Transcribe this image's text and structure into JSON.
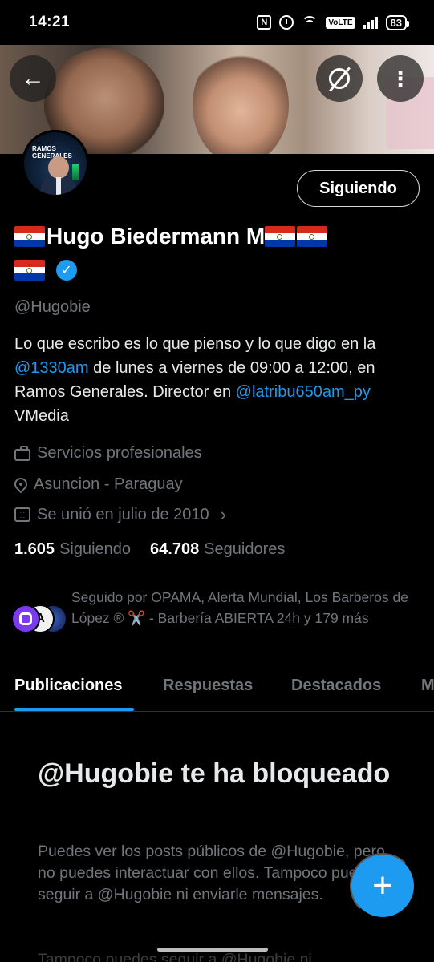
{
  "status_bar": {
    "time": "14:21",
    "nfc_label": "N",
    "volte_label": "VoLTE",
    "battery": "83"
  },
  "header": {
    "back_icon": "←",
    "more_icon": "⋮"
  },
  "profile": {
    "following_button": "Siguiendo",
    "name": "Hugo Biedermann M",
    "verified_check": "✓",
    "handle": "@Hugobie",
    "bio": {
      "part1": "Lo que escribo es lo que pienso y lo que digo en la ",
      "mention1": "@1330am",
      "part2": " de lunes a viernes de 09:00 a 12:00, en Ramos Generales. Director en ",
      "mention2": "@latribu650am_py",
      "part3": " VMedia"
    },
    "category": "Servicios profesionales",
    "location": "Asuncion - Paraguay",
    "joined": "Se unió en julio de 2010",
    "joined_chevron": "›",
    "following_count": "1.605",
    "following_label": "Siguiendo",
    "followers_count": "64.708",
    "followers_label": "Seguidores",
    "followed_by": "Seguido por OPAMA, Alerta Mundial, Los Barberos de López ® ✂️ - Barbería ABIERTA 24h y 179 más",
    "avatar_text": "RAMOS GENERALES"
  },
  "tabs": [
    "Publicaciones",
    "Respuestas",
    "Destacados",
    "M"
  ],
  "blocked": {
    "title": "@Hugobie te ha bloqueado",
    "body": "Puedes ver los posts públicos de @Hugobie, pero no puedes interactuar con ellos. Tampoco puedes seguir a @Hugobie ni enviarle mensajes.",
    "ghost": "Tampoco puedes seguir a @Hugobie ni"
  },
  "fab_icon": "+",
  "colors": {
    "accent": "#1d9bf0",
    "text_primary": "#e7e9ea",
    "text_secondary": "#71767b",
    "background": "#000000"
  }
}
